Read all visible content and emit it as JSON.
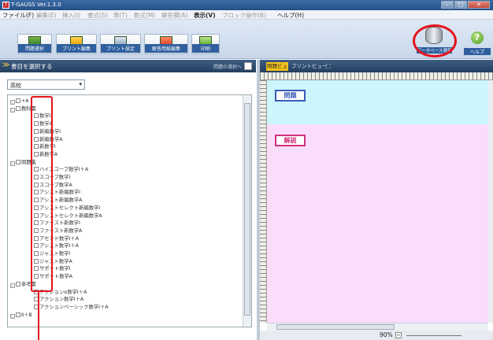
{
  "titlebar": {
    "title": "T-GAUSS Ver.1.3.0",
    "min": "–",
    "max": "□",
    "close": "✕"
  },
  "menu": [
    {
      "label": "ファイル(F)",
      "dim": false
    },
    {
      "label": "編集(E)",
      "dim": true
    },
    {
      "label": "挿入(I)",
      "dim": true
    },
    {
      "label": "書式(S)",
      "dim": true
    },
    {
      "label": "表(T)",
      "dim": true
    },
    {
      "label": "数式(M)",
      "dim": true
    },
    {
      "label": "解答欄(A)",
      "dim": true
    },
    {
      "label": "表示(V)",
      "dim": false
    },
    {
      "label": "ブロック操作(B)",
      "dim": true
    },
    {
      "label": "ヘルプ(H)",
      "dim": false
    }
  ],
  "toolbar": {
    "buttons": [
      "問題選択",
      "プリント編集",
      "プリント設定",
      "解答用紙編集",
      "印刷"
    ],
    "db_label": "データベース選択",
    "help_label": "ヘルプ"
  },
  "left": {
    "header": "書目を選択する",
    "header_right": "問題の選択へ",
    "select_value": "高校",
    "tree": [
      {
        "label": "+A",
        "level": 0,
        "exp": "□"
      },
      {
        "label": "教科書",
        "level": 0,
        "exp": "□"
      },
      {
        "label": "数学Ⅰ",
        "level": 1
      },
      {
        "label": "数学A",
        "level": 1
      },
      {
        "label": "新編数学Ⅰ",
        "level": 1
      },
      {
        "label": "新編数学A",
        "level": 1
      },
      {
        "label": "新数学Ⅰ",
        "level": 1
      },
      {
        "label": "新数学A",
        "level": 1
      },
      {
        "label": "問題集",
        "level": 0,
        "exp": "□"
      },
      {
        "label": "ハイスコープ数学Ⅰ＋A",
        "level": 1
      },
      {
        "label": "スコープ数学Ⅰ",
        "level": 1
      },
      {
        "label": "スコープ数学A",
        "level": 1
      },
      {
        "label": "アシスト新編数学Ⅰ",
        "level": 1
      },
      {
        "label": "アシスト新編数学A",
        "level": 1
      },
      {
        "label": "アシストセレクト新編数学Ⅰ",
        "level": 1
      },
      {
        "label": "アシストセレクト新編数学A",
        "level": 1
      },
      {
        "label": "ファースト新数学Ⅰ",
        "level": 1
      },
      {
        "label": "ファースト新数学A",
        "level": 1
      },
      {
        "label": "アセンド数学Ⅰ＋A",
        "level": 1
      },
      {
        "label": "アシスト数学Ⅰ＋A",
        "level": 1
      },
      {
        "label": "ジャスト数学Ⅰ",
        "level": 1
      },
      {
        "label": "ジャスト数学A",
        "level": 1
      },
      {
        "label": "サポート数学Ⅰ",
        "level": 1
      },
      {
        "label": "サポート数学A",
        "level": 1
      },
      {
        "label": "参考書",
        "level": 0,
        "exp": "□"
      },
      {
        "label": "アクションα数学Ⅰ＋A",
        "level": 1
      },
      {
        "label": "アクション数学Ⅰ＋A",
        "level": 1
      },
      {
        "label": "アクションベーシック数学Ⅰ＋A",
        "level": 1
      },
      {
        "label": "Ⅱ＋B",
        "level": 0,
        "exp": "□"
      }
    ]
  },
  "right": {
    "tab_problem": "問題ビュー",
    "tab_print": "プリントビュー",
    "tab_expand": "⛶",
    "q_label": "問題",
    "a_label": "解説",
    "zoom": "90%",
    "zoom_minus": "−"
  }
}
